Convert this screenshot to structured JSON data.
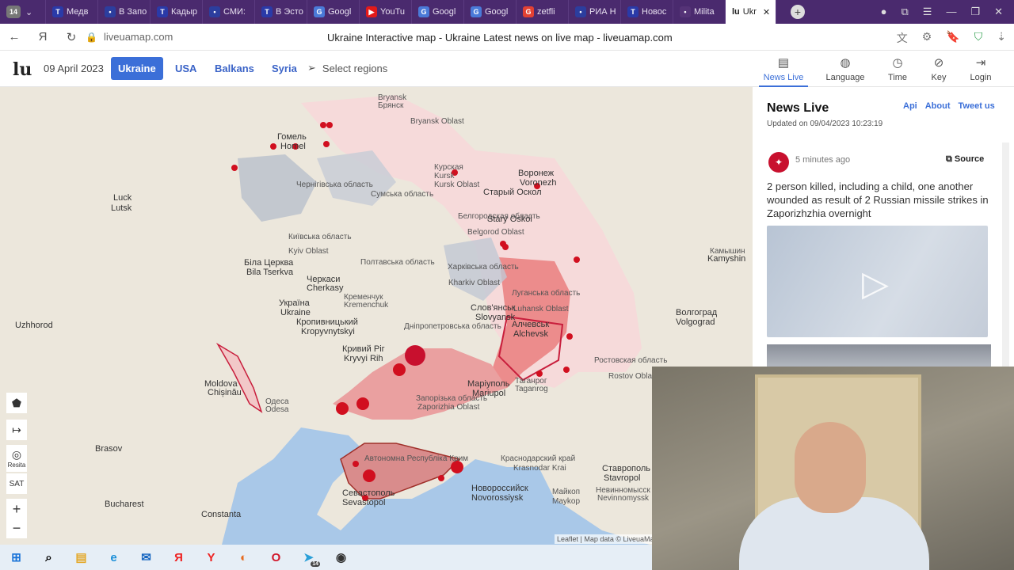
{
  "browser": {
    "tab_count": "14",
    "tabs": [
      {
        "label": "Медв",
        "icon": "T",
        "color": "#2a3aa8"
      },
      {
        "label": "В Запо",
        "icon": "•",
        "color": "#2c3e9e"
      },
      {
        "label": "Кадыр",
        "icon": "T",
        "color": "#2a3aa8"
      },
      {
        "label": "СМИ:",
        "icon": "•",
        "color": "#2c3e9e"
      },
      {
        "label": "В Эсто",
        "icon": "T",
        "color": "#2a3aa8"
      },
      {
        "label": "Googl",
        "icon": "G",
        "color": "#4a7ad8"
      },
      {
        "label": "YouTu",
        "icon": "▶",
        "color": "#e21a1a"
      },
      {
        "label": "Googl",
        "icon": "G",
        "color": "#4a7ad8"
      },
      {
        "label": "Googl",
        "icon": "G",
        "color": "#4a7ad8"
      },
      {
        "label": "zetfli",
        "icon": "G",
        "color": "#e34133"
      },
      {
        "label": "РИА Н",
        "icon": "•",
        "color": "#2c3e9e"
      },
      {
        "label": "Новос",
        "icon": "T",
        "color": "#2a3aa8"
      },
      {
        "label": "Milita",
        "icon": "•",
        "color": "#553377"
      }
    ],
    "active_tab": "Ukr",
    "url": "liveuamap.com",
    "page_title": "Ukraine Interactive map - Ukraine Latest news on live map - liveuamap.com"
  },
  "site": {
    "logo": "lu",
    "date": "09 April 2023",
    "regions": [
      "Ukraine",
      "USA",
      "Balkans",
      "Syria"
    ],
    "select_regions": "Select regions",
    "menu": [
      {
        "label": "News Live",
        "icon": "▤"
      },
      {
        "label": "Language",
        "icon": "◍"
      },
      {
        "label": "Time",
        "icon": "◷"
      },
      {
        "label": "Key",
        "icon": "⊘"
      },
      {
        "label": "Login",
        "icon": "⇥"
      }
    ]
  },
  "map": {
    "labels": [
      "Bryansk",
      "Брянск",
      "Bryansk Oblast",
      "Курская",
      "Kursk",
      "Kursk Oblast",
      "Воронеж",
      "Voronezh",
      "Старый Оскол",
      "Stary Oskol",
      "Белгородская область",
      "Belgorod Oblast",
      "Гомель",
      "Homel",
      "Чернігівська область",
      "Сумська область",
      "Київська область",
      "Kyiv Oblast",
      "Luck",
      "Lutsk",
      "Біла Церква",
      "Bila Tserkva",
      "Черкаси",
      "Cherkasy",
      "Кременчук",
      "Kremenchuk",
      "Україна",
      "Ukraine",
      "Кропивницький",
      "Kropyvnytskyi",
      "Полтавська область",
      "Харківська область",
      "Kharkiv Oblast",
      "Слов'янськ",
      "Slovyansk",
      "Луганська область",
      "Luhansk Oblast",
      "Алчевськ",
      "Alchevsk",
      "Кривий Ріг",
      "Kryvyi Rih",
      "Дніпропетровська область",
      "Запорізька область",
      "Zaporizhia Oblast",
      "Маріуполь",
      "Mariupol",
      "Таганрог",
      "Taganrog",
      "Ростовская область",
      "Rostov Oblast",
      "Волгоград",
      "Volgograd",
      "Moldova",
      "Chișinău",
      "Одеса",
      "Odesa",
      "Автономна Республіка Крим",
      "Севастополь",
      "Sevastopol",
      "Новороссийск",
      "Novorossiysk",
      "Краснодарский край",
      "Krasnodar Krai",
      "Ставрополь",
      "Stavropol",
      "Невинномысск",
      "Nevinnomyssk",
      "Майкоп",
      "Maykop",
      "Bucharest",
      "Brasov",
      "Constanta",
      "Uzhhorod",
      "Kamyshin",
      "Камышин"
    ],
    "tools": [
      "⬟",
      "↦",
      "◎",
      "SAT",
      "+",
      "−"
    ],
    "tool_extra": "Resita",
    "attribution": "Leaflet | Map data © LiveuaMap"
  },
  "panel": {
    "title": "News Live",
    "links": [
      "Api",
      "About",
      "Tweet us"
    ],
    "updated": "Updated on 09/04/2023 10:23:19",
    "card": {
      "time": "5 minutes ago",
      "source": "Source",
      "text": "2 person killed, including a child, one another wounded as result of 2 Russian missile strikes in Zaporizhzhia overnight"
    }
  },
  "taskbar": {
    "icons": [
      "⊞",
      "⌕",
      "▤",
      "e",
      "✉",
      "Я",
      "Y",
      "◐",
      "O",
      "➤",
      "◉"
    ],
    "telegram_badge": "14"
  }
}
